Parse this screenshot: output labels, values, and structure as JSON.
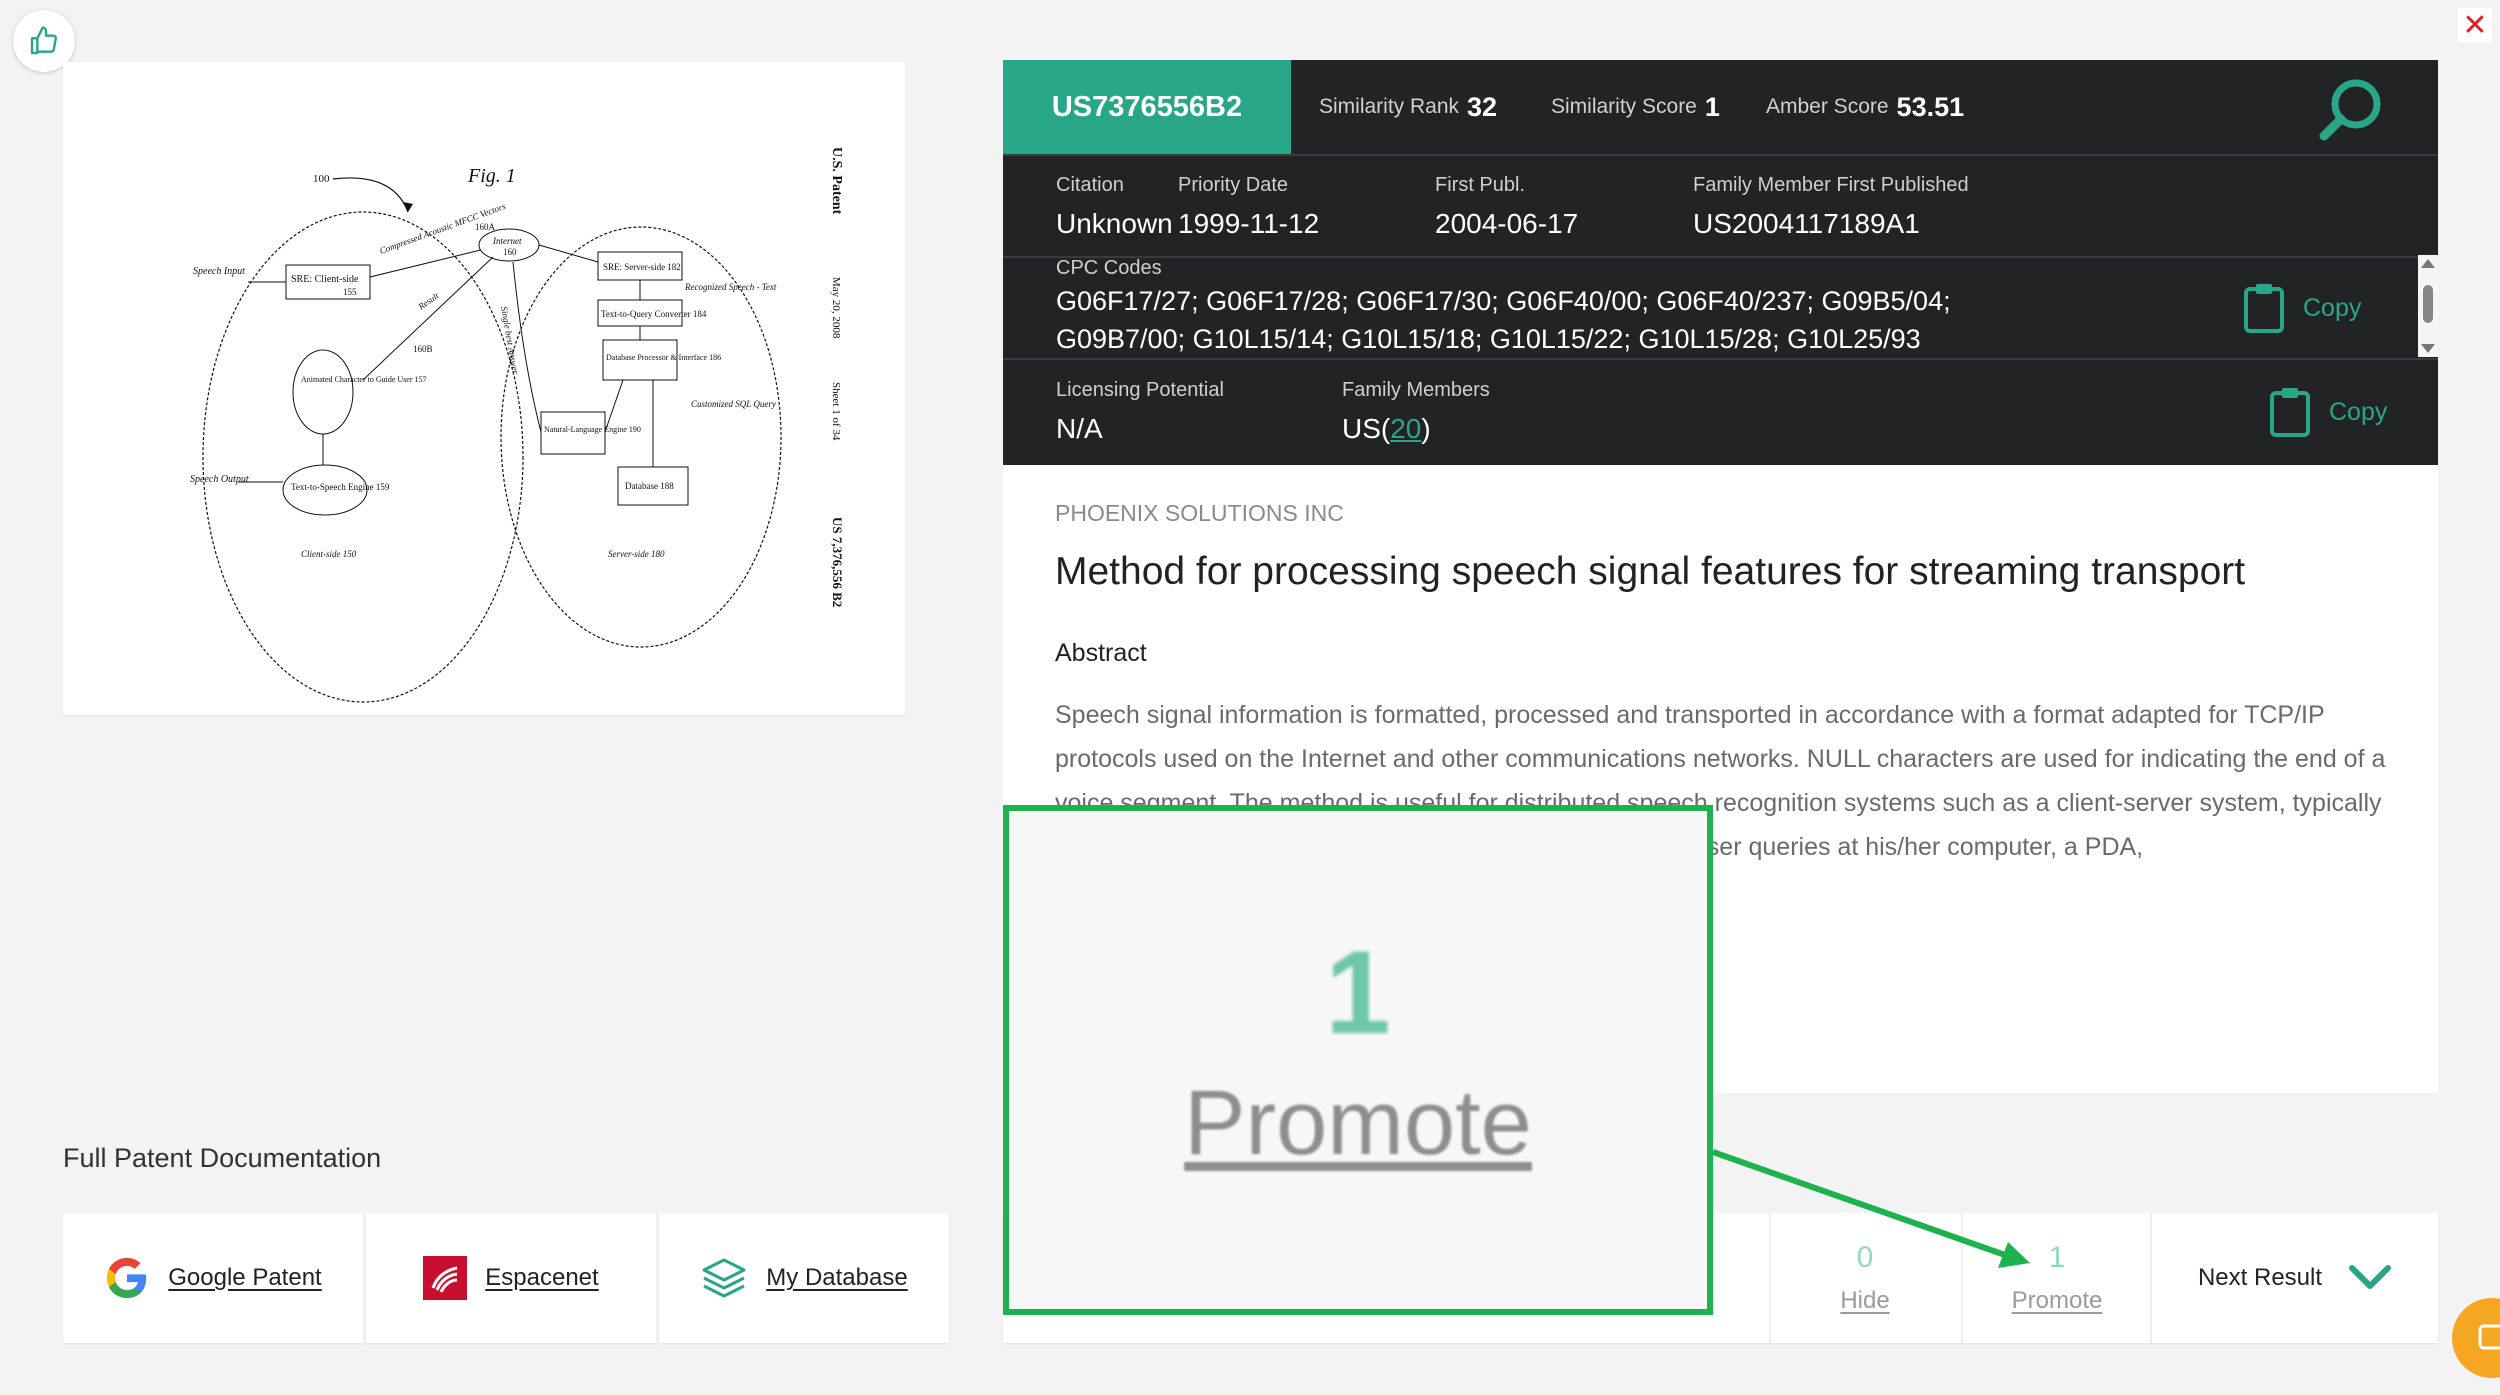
{
  "patent": {
    "number": "US7376556B2",
    "metrics": [
      {
        "label": "Similarity Rank",
        "value": "32"
      },
      {
        "label": "Similarity Score",
        "value": "1"
      },
      {
        "label": "Amber Score",
        "value": "53.51"
      }
    ],
    "row1": [
      {
        "label": "Citation",
        "value": "Unknown"
      },
      {
        "label": "Priority Date",
        "value": "1999-11-12"
      },
      {
        "label": "First Publ.",
        "value": "2004-06-17"
      },
      {
        "label": "Family Member First Published",
        "value": "US2004117189A1"
      }
    ],
    "cpc": {
      "label": "CPC Codes",
      "line1": "G06F17/27; G06F17/28; G06F17/30; G06F40/00; G06F40/237; G09B5/04;",
      "line2": "G09B7/00; G10L15/14; G10L15/18; G10L15/22; G10L15/28; G10L25/93",
      "copy_label": "Copy"
    },
    "licensing": {
      "label": "Licensing Potential",
      "value": "N/A"
    },
    "family": {
      "label": "Family Members",
      "prefix": "US(",
      "count": "20",
      "suffix": ")",
      "copy_label": "Copy"
    },
    "assignee": "PHOENIX SOLUTIONS INC",
    "title": "Method for processing speech signal features for streaming transport",
    "abstract_heading": "Abstract",
    "abstract": "Speech signal information is formatted, processed and transported in accordance with a format adapted for TCP/IP protocols used on the Internet and other communications networks. NULL characters are used for indicating the end of a voice segment. The method is useful for distributed speech recognition systems such as a client-server system, typically implemented on an intranet or over the Internet based on user queries at his/her computer, a PDA,"
  },
  "drawing": {
    "fig_label": "Fig. 1",
    "side_text": [
      "U.S. Patent",
      "May 20, 2008",
      "Sheet 1 of 34",
      "US 7,376,556 B2"
    ],
    "labels": {
      "ref100": "100",
      "speech_input": "Speech Input",
      "sre_client": "SRE: Client-side",
      "sre_client_num": "155",
      "compressed": "Compressed Acoustic MFCC Vectors",
      "ref160a": "160A",
      "internet": "Internet",
      "internet_num": "160",
      "sre_server": "SRE: Server-side 182",
      "recognized": "Recognized Speech - Text",
      "ttq": "Text-to-Query Converter 184",
      "db_proc": "Database Processor & Interface 186",
      "custom_sql": "Customized SQL Query",
      "nle": "Natural-Language Engine 190",
      "database": "Database 188",
      "result": "Result",
      "single_best": "Single best Answer",
      "ref160b": "160B",
      "animated": "Animated Character to Guide User 157",
      "speech_output": "Speech Output",
      "tts": "Text-to-Speech Engine 159",
      "client_side": "Client-side 150",
      "server_side": "Server-side 180"
    }
  },
  "docs": {
    "heading": "Full Patent Documentation",
    "buttons": [
      "Google Patent",
      "Espacenet",
      "My Database"
    ]
  },
  "actions": {
    "hide": {
      "count": "0",
      "label": "Hide"
    },
    "promote": {
      "count": "1",
      "label": "Promote"
    },
    "next": "Next Result"
  },
  "zoom": {
    "count": "1",
    "label": "Promote"
  },
  "colors": {
    "accent": "#28a688",
    "panel": "#222325",
    "callout": "#1db24d"
  }
}
